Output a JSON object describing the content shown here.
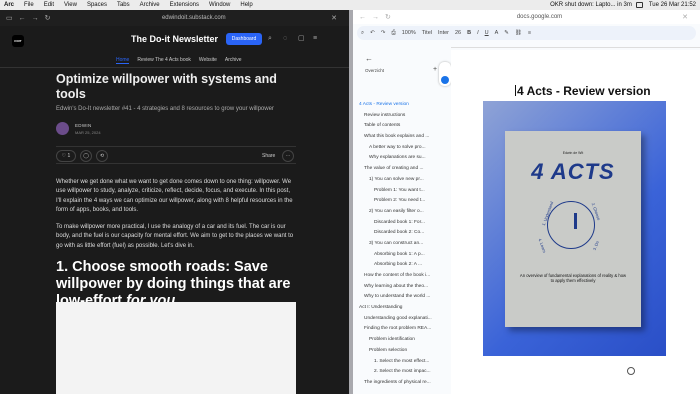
{
  "menubar": {
    "app": "Arc",
    "items": [
      "File",
      "Edit",
      "View",
      "Spaces",
      "Tabs",
      "Archive",
      "Extensions",
      "Window",
      "Help"
    ],
    "notification": "OKR shut down: Lapto... in 3m",
    "datetime": "Tue 26 Mar 21:52"
  },
  "left": {
    "url": "edwindoit.substack.com",
    "logo_text": "DOIT",
    "publication": "The Do-it Newsletter",
    "dashboard": "Dashboard",
    "nav": [
      "Home",
      "Review The 4 Acts book",
      "Website",
      "Archive"
    ],
    "title": "Optimize willpower with systems and tools",
    "subtitle": "Edwin's Do-It newsletter #41 - 4 strategies and 8 resources to grow your willpower",
    "author": "EDWIN",
    "date": "MAR 25, 2024",
    "likes": "1",
    "share": "Share",
    "p1": "Whether we get done what we want to get done comes down to one thing: willpower. We use willpower to study, analyze, criticize, reflect, decide, focus, and execute. In this post, I'll explain the 4 ways we can optimize our willpower, along with 8 helpful resources in the form of apps, books, and tools.",
    "p2": "To make willpower more practical, I use the analogy of a car and its fuel. The car is our body, and the fuel is our capacity for mental effort. We aim to get to the places we want to go with as little effort (fuel) as possible. Let's dive in.",
    "h1_main": "1. Choose smooth roads: Save willpower by doing things that are low-effort",
    "h1_em": "for you"
  },
  "right": {
    "url": "docs.google.com",
    "toolbar": {
      "zoom": "100%",
      "style": "Titel",
      "font": "Inter",
      "size": "26",
      "bold": "B",
      "italic": "I",
      "underline": "U",
      "color": "A"
    },
    "overview": "Overzicht",
    "outline": [
      {
        "label": "4 Acts - Review version",
        "indent": 0,
        "sel": true
      },
      {
        "label": "Review instructions",
        "indent": 1
      },
      {
        "label": "Table of contents",
        "indent": 1
      },
      {
        "label": "What this book explains and ...",
        "indent": 1
      },
      {
        "label": "A better way to solve pro...",
        "indent": 2
      },
      {
        "label": "Why explanations are su...",
        "indent": 2
      },
      {
        "label": "The value of creating and ...",
        "indent": 1
      },
      {
        "label": "1) You can solve new pr...",
        "indent": 2
      },
      {
        "label": "Problem 1: You want t...",
        "indent": 3
      },
      {
        "label": "Problem 2: You need t...",
        "indent": 3
      },
      {
        "label": "2) You can easily filter o...",
        "indent": 2
      },
      {
        "label": "Discarded book 1: For...",
        "indent": 3
      },
      {
        "label": "Discarded book 2: Co...",
        "indent": 3
      },
      {
        "label": "3) You can construct an...",
        "indent": 2
      },
      {
        "label": "Absorbing book 1: A p...",
        "indent": 3
      },
      {
        "label": "Absorbing book 2: A ...",
        "indent": 3
      },
      {
        "label": "How the content of the book i...",
        "indent": 1
      },
      {
        "label": "Why learning about the theo...",
        "indent": 1
      },
      {
        "label": "Why to understand the world ...",
        "indent": 1
      },
      {
        "label": "Act I: Understanding",
        "indent": 0
      },
      {
        "label": "Understanding good explanati...",
        "indent": 1
      },
      {
        "label": "Finding the root problem REA...",
        "indent": 1
      },
      {
        "label": "Problem identification",
        "indent": 2
      },
      {
        "label": "Problem selection",
        "indent": 2
      },
      {
        "label": "1. Select the most effect...",
        "indent": 3
      },
      {
        "label": "2. Select the most impac...",
        "indent": 3
      },
      {
        "label": "The ingredients of physical re...",
        "indent": 1
      }
    ],
    "doc_title": "4 Acts - Review version",
    "book": {
      "author": "Edwin de Wit",
      "title": "4 ACTS",
      "labels": [
        "1. Understand",
        "2. Choose",
        "3. Do",
        "4. Learn"
      ],
      "subtitle": "An overview of fundamental explanations of reality & how to apply them effectively"
    }
  }
}
